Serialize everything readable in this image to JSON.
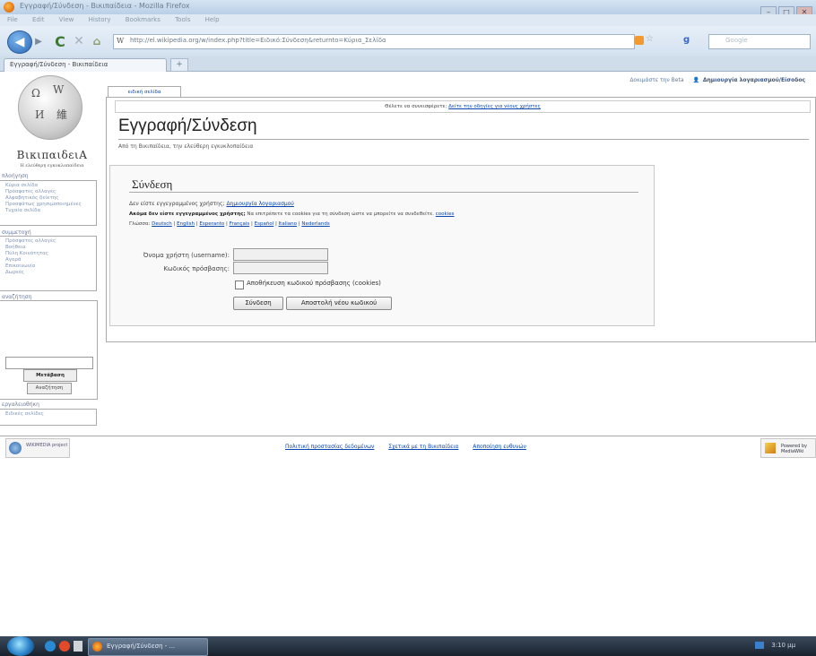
{
  "browser": {
    "window_title": "Εγγραφή/Σύνδεση - Βικιπαίδεια - Mozilla Firefox",
    "menu": [
      "File",
      "Edit",
      "View",
      "History",
      "Bookmarks",
      "Tools",
      "Help"
    ],
    "url": "http://el.wikipedia.org/w/index.php?title=Ειδικό:Σύνδεση&returnto=Κύρια_Σελίδα",
    "search_placeholder": "Google",
    "tab_title": "Εγγραφή/Σύνδεση - Βικιπαίδεια",
    "new_tab": "+"
  },
  "wiki": {
    "logo_name": "ΒικιπαιδειΑ",
    "logo_slogan": "Η ελεύθερη εγκυκλοπαίδεια",
    "special_tab": "ειδική σελίδα",
    "user_links": {
      "first": "Δοκιμάστε την Beta",
      "create_login": "Δημιουργία λογαριασμού/Είσοδος"
    },
    "sitenotice_text": "Θέλετε να συνεισφέρετε;",
    "sitenotice_link": "Δείτε την οδηγίες για νέους χρήστες",
    "heading": "Εγγραφή/Σύνδεση",
    "sitesub": "Από τη Βικιπαίδεια, την ελεύθερη εγκυκλοπαίδεια",
    "navigation": {
      "header": "πλοήγηση",
      "items": [
        "Κύρια σελίδα",
        "Πρόσφατες αλλαγές",
        "Αλφαβητικός δείκτης",
        "Προσφάτως χρησιμοποιημένες",
        "Τυχαία σελίδα"
      ]
    },
    "interaction": {
      "header": "συμμετοχή",
      "items": [
        "Πρόσφατες αλλαγές",
        "Βοήθεια",
        "Πύλη Κοινότητας",
        "Αγορά",
        "Επικοινωνία",
        "Δωρεές"
      ]
    },
    "search": {
      "header": "αναζήτηση",
      "go": "Μετάβαση",
      "search": "Αναζήτηση"
    },
    "toolbox": {
      "header": "εργαλειοθήκη",
      "items": [
        "Ειδικές σελίδες"
      ]
    },
    "login": {
      "legend": "Σύνδεση",
      "no_account_text": "Δεν είστε εγγεγραμμένος χρήστης;",
      "no_account_link": "Δημιουργία λογαριασμού",
      "cookies_bold": "Ακόμα δεν είστε εγγεγραμμένος χρήστης;",
      "cookies_text": "Να επιτρέπετε τα cookies για τη σύνδεση ώστε να μπορείτε να συνδεθείτε.",
      "cookies_link": "cookies",
      "langs_label": "Γλώσσα:",
      "languages": [
        "Deutsch",
        "English",
        "Esperanto",
        "Français",
        "Español",
        "Italiano",
        "Nederlands"
      ],
      "username_label": "Όνομα χρήστη (username):",
      "password_label": "Κωδικός πρόσβασης:",
      "remember_label": "Αποθήκευση κωδικού πρόσβασης (cookies)",
      "login_button": "Σύνδεση",
      "mail_button": "Αποστολή νέου κωδικού"
    },
    "footer": {
      "logo_text": "WIKIMEDIA project",
      "links": [
        "Πολιτική προστασίας δεδομένων",
        "Σχετικά με τη Βικιπαίδεια",
        "Αποποίηση ευθυνών"
      ],
      "mediawiki_text": "Powered by MediaWiki"
    }
  },
  "taskbar": {
    "task_label": "Εγγραφή/Σύνδεση - ...",
    "clock": "3:10 μμ"
  }
}
